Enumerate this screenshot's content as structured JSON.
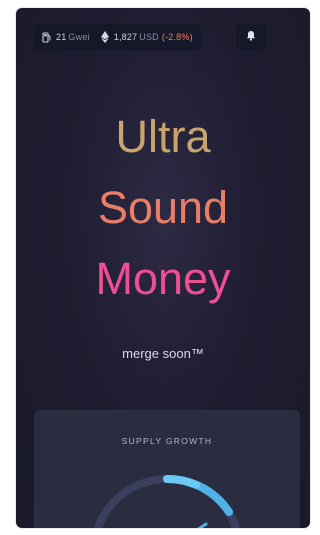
{
  "header": {
    "gas": {
      "value": "21",
      "unit": "Gwei"
    },
    "eth_price": {
      "value": "1,827",
      "currency": "USD",
      "change": "(-2.8%)"
    },
    "icons": {
      "gas": "gas-pump-icon",
      "eth": "ethereum-icon",
      "bell": "bell-icon"
    }
  },
  "hero": {
    "line1": "Ultra",
    "line2": "Sound",
    "line3": "Money",
    "subtitle": "merge soon™"
  },
  "supply_card": {
    "label": "SUPPLY GROWTH"
  },
  "colors": {
    "background": "#1f1d31",
    "ultra": "#c9a46d",
    "sound": "#e97e67",
    "money": "#ee4e92",
    "negative": "#ff7a62",
    "gauge_track": "#3b3e5c",
    "gauge_fill": "#4fb2e6"
  }
}
